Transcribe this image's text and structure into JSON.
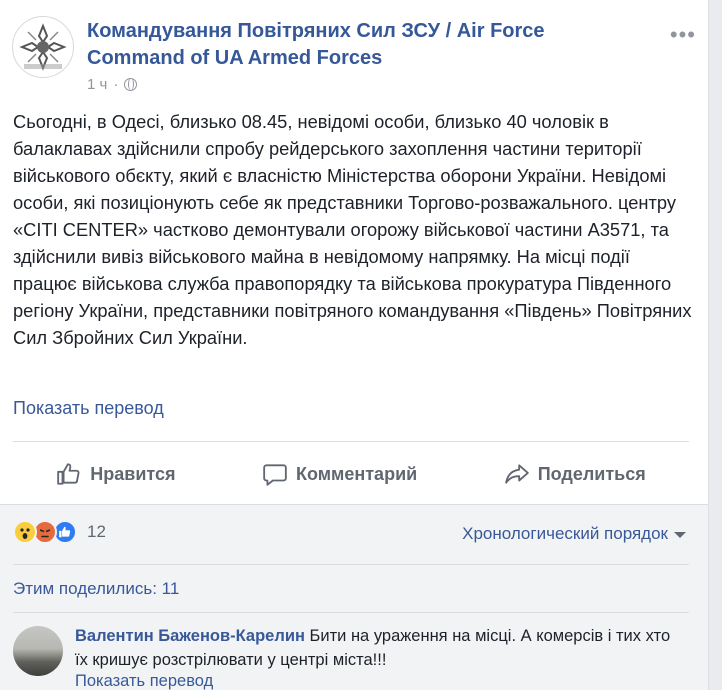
{
  "post": {
    "page_name": "Командування Повітряних Сил ЗСУ / Air Force Command of UA Armed Forces",
    "time": "1 ч",
    "privacy_icon": "globe-icon",
    "more_icon": "more-horizontal-icon",
    "text": "Сьогодні, в Одесі, близько 08.45, невідомі особи, близько 40 чоловік в балаклавах здійснили спробу рейдерського захоплення частини території військового обєкту, який є власністю Міністерства оборони України. Невідомі особи, які позиціонують себе як представники Торгово-розважального. центру «CITI CENTER» частково демонтували огорожу військової частини А3571, та здійснили вивіз військового майна в невідомому напрямку. На місці події працює військова служба правопорядку та військова прокуратура Південного регіону України, представники повітряного командування «Південь» Повітряних Сил Збройних Сил України.",
    "translate_label": "Показать перевод"
  },
  "actions": {
    "like_label": "Нравится",
    "comment_label": "Комментарий",
    "share_label": "Поделиться"
  },
  "reactions": {
    "types": [
      "wow",
      "angry",
      "like"
    ],
    "count": "12"
  },
  "comments_order": "Хронологический порядок",
  "shares_label": "Этим поделились: 11",
  "comment": {
    "author": "Валентин Баженов-Карелин",
    "text": "Бити на ураження на місці. А комерсів і тих хто їх кришує розстрілювати у центрі міста!!!",
    "translate_label": "Показать перевод"
  },
  "colors": {
    "link": "#385898",
    "text": "#1d2129",
    "muted": "#606770",
    "like_blue": "#2e7bf6"
  }
}
